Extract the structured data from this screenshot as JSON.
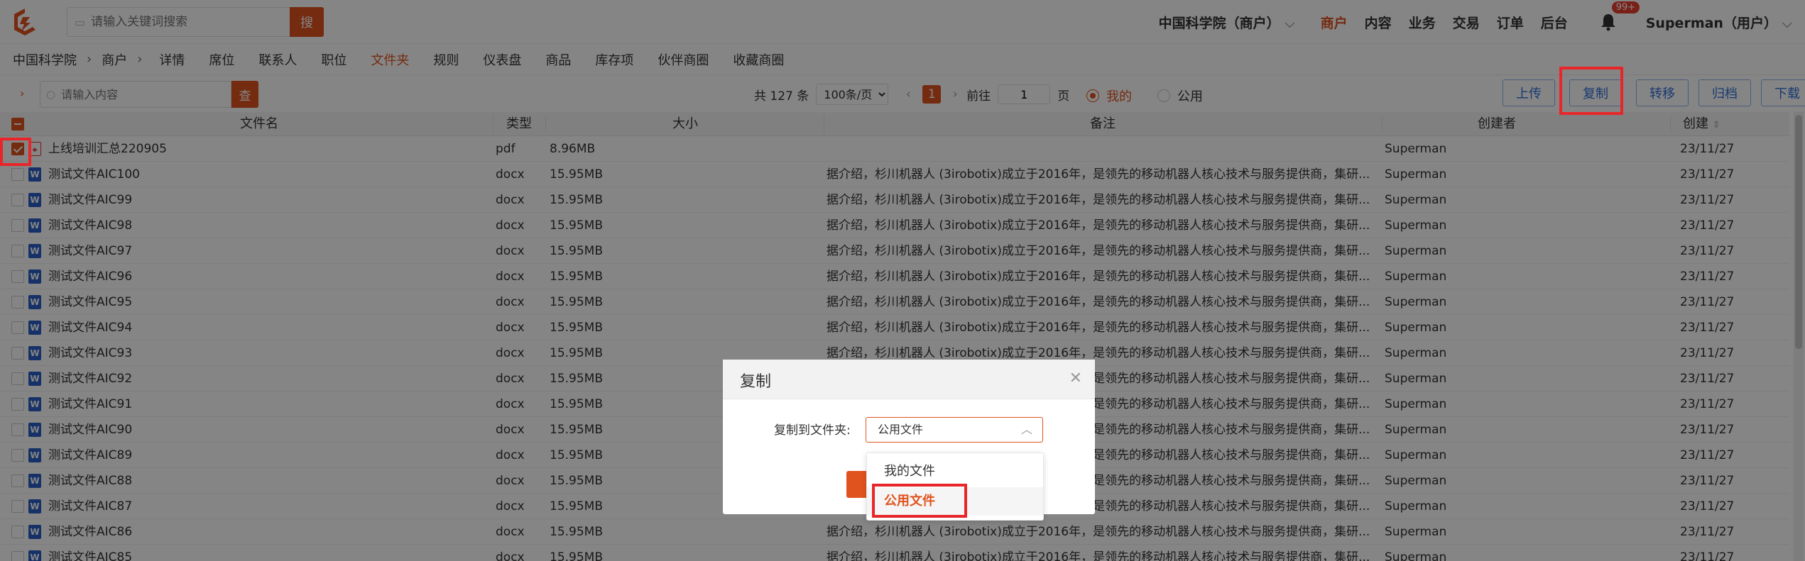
{
  "header": {
    "search_placeholder": "请输入关键词搜索",
    "search_button": "搜",
    "merchant": "中国科学院（商户）",
    "nav": [
      "商户",
      "内容",
      "业务",
      "交易",
      "订单",
      "后台"
    ],
    "active_nav": "商户",
    "badge": "99+",
    "user": "Superman（用户）"
  },
  "breadcrumb": [
    "中国科学院",
    "商户"
  ],
  "subtabs": [
    "详情",
    "席位",
    "联系人",
    "职位",
    "文件夹",
    "规则",
    "仪表盘",
    "商品",
    "库存项",
    "伙伴商圈",
    "收藏商圈"
  ],
  "active_subtab": "文件夹",
  "toolbar": {
    "search_placeholder": "请输入内容",
    "search_button": "查",
    "total": "共 127 条",
    "page_size": "100条/页",
    "current_page": "1",
    "goto_label": "前往",
    "goto_value": "1",
    "page_label": "页",
    "radio_mine": "我的",
    "radio_public": "公用",
    "actions": [
      "上传",
      "复制",
      "转移",
      "归档",
      "下载"
    ]
  },
  "table": {
    "columns": [
      "文件名",
      "类型",
      "大小",
      "备注",
      "创建者",
      "创建"
    ],
    "rows": [
      {
        "name": "上线培训汇总220905",
        "type": "pdf",
        "size": "8.96MB",
        "note": "",
        "creator": "Superman",
        "created": "23/11/27",
        "checked": true
      },
      {
        "name": "测试文件AIC100",
        "type": "docx",
        "size": "15.95MB",
        "note": "据介绍，杉川机器人 (3irobotix)成立于2016年，是领先的移动机器人核心技术与服务提供商，集研...",
        "creator": "Superman",
        "created": "23/11/27"
      },
      {
        "name": "测试文件AIC99",
        "type": "docx",
        "size": "15.95MB",
        "note": "据介绍，杉川机器人 (3irobotix)成立于2016年，是领先的移动机器人核心技术与服务提供商，集研...",
        "creator": "Superman",
        "created": "23/11/27"
      },
      {
        "name": "测试文件AIC98",
        "type": "docx",
        "size": "15.95MB",
        "note": "据介绍，杉川机器人 (3irobotix)成立于2016年，是领先的移动机器人核心技术与服务提供商，集研...",
        "creator": "Superman",
        "created": "23/11/27"
      },
      {
        "name": "测试文件AIC97",
        "type": "docx",
        "size": "15.95MB",
        "note": "据介绍，杉川机器人 (3irobotix)成立于2016年，是领先的移动机器人核心技术与服务提供商，集研...",
        "creator": "Superman",
        "created": "23/11/27"
      },
      {
        "name": "测试文件AIC96",
        "type": "docx",
        "size": "15.95MB",
        "note": "据介绍，杉川机器人 (3irobotix)成立于2016年，是领先的移动机器人核心技术与服务提供商，集研...",
        "creator": "Superman",
        "created": "23/11/27"
      },
      {
        "name": "测试文件AIC95",
        "type": "docx",
        "size": "15.95MB",
        "note": "据介绍，杉川机器人 (3irobotix)成立于2016年，是领先的移动机器人核心技术与服务提供商，集研...",
        "creator": "Superman",
        "created": "23/11/27"
      },
      {
        "name": "测试文件AIC94",
        "type": "docx",
        "size": "15.95MB",
        "note": "据介绍，杉川机器人 (3irobotix)成立于2016年，是领先的移动机器人核心技术与服务提供商，集研...",
        "creator": "Superman",
        "created": "23/11/27"
      },
      {
        "name": "测试文件AIC93",
        "type": "docx",
        "size": "15.95MB",
        "note": "据介绍，杉川机器人 (3irobotix)成立于2016年，是领先的移动机器人核心技术与服务提供商，集研...",
        "creator": "Superman",
        "created": "23/11/27"
      },
      {
        "name": "测试文件AIC92",
        "type": "docx",
        "size": "15.95MB",
        "note": "据介绍，杉川机器人 (3irobotix)成立于2016年，是领先的移动机器人核心技术与服务提供商，集研...",
        "creator": "Superman",
        "created": "23/11/27"
      },
      {
        "name": "测试文件AIC91",
        "type": "docx",
        "size": "15.95MB",
        "note": "据介绍，杉川机器人 (3irobotix)成立于2016年，是领先的移动机器人核心技术与服务提供商，集研...",
        "creator": "Superman",
        "created": "23/11/27"
      },
      {
        "name": "测试文件AIC90",
        "type": "docx",
        "size": "15.95MB",
        "note": "据介绍，杉川机器人 (3irobotix)成立于2016年，是领先的移动机器人核心技术与服务提供商，集研...",
        "creator": "Superman",
        "created": "23/11/27"
      },
      {
        "name": "测试文件AIC89",
        "type": "docx",
        "size": "15.95MB",
        "note": "据介绍，杉川机器人 (3irobotix)成立于2016年，是领先的移动机器人核心技术与服务提供商，集研...",
        "creator": "Superman",
        "created": "23/11/27"
      },
      {
        "name": "测试文件AIC88",
        "type": "docx",
        "size": "15.95MB",
        "note": "据介绍，杉川机器人 (3irobotix)成立于2016年，是领先的移动机器人核心技术与服务提供商，集研...",
        "creator": "Superman",
        "created": "23/11/27"
      },
      {
        "name": "测试文件AIC87",
        "type": "docx",
        "size": "15.95MB",
        "note": "据介绍，杉川机器人 (3irobotix)成立于2016年，是领先的移动机器人核心技术与服务提供商，集研...",
        "creator": "Superman",
        "created": "23/11/27"
      },
      {
        "name": "测试文件AIC86",
        "type": "docx",
        "size": "15.95MB",
        "note": "据介绍，杉川机器人 (3irobotix)成立于2016年，是领先的移动机器人核心技术与服务提供商，集研...",
        "creator": "Superman",
        "created": "23/11/27"
      },
      {
        "name": "测试文件AIC85",
        "type": "docx",
        "size": "15.95MB",
        "note": "据介绍，杉川机器人 (3irobotix)成立于2016年，是领先的移动机器人核心技术与服务提供商，集研...",
        "creator": "Superman",
        "created": "23/11/27"
      }
    ]
  },
  "modal": {
    "title": "复制",
    "label": "复制到文件夹:",
    "selected": "公用文件",
    "options": [
      "我的文件",
      "公用文件"
    ]
  },
  "colors": {
    "accent": "#e0531f",
    "highlight": "#e8262a",
    "link_blue": "#2f6fd8"
  }
}
